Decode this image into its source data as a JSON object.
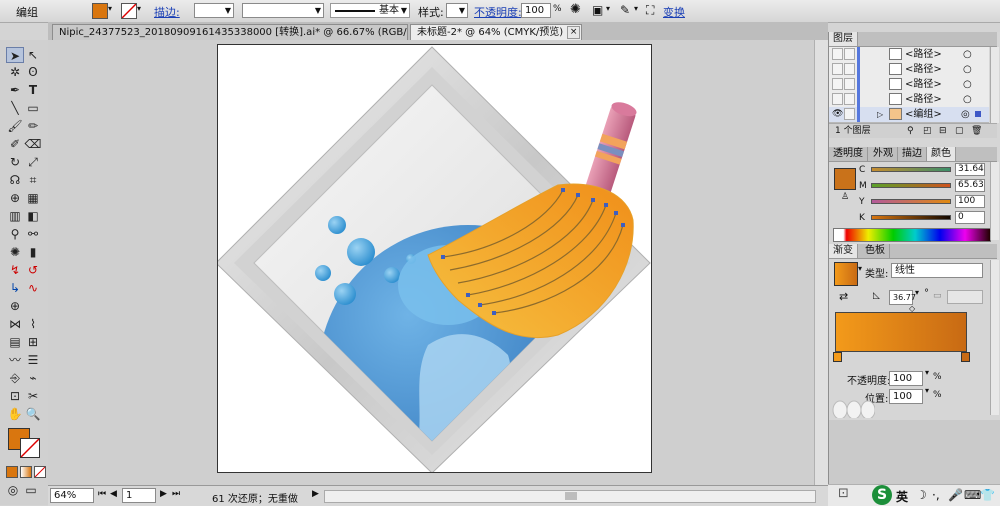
{
  "control_bar": {
    "group_label": "编组",
    "stroke_label": "描边:",
    "brush_label": "基本",
    "style_label": "样式:",
    "opacity_label": "不透明度:",
    "opacity_value": "100",
    "opacity_unit": "%",
    "transform_label": "变换"
  },
  "tabs": [
    {
      "label": "Nipic_24377523_20180909161435338000 [转换].ai* @ 66.67% (RGB/预览)"
    },
    {
      "label": "未标题-2* @ 64% (CMYK/预览)"
    }
  ],
  "status": {
    "zoom": "64%",
    "page": "1",
    "history": "61 次还原；无重做"
  },
  "layers_panel": {
    "title": "图层",
    "items": [
      {
        "label": "<路径>"
      },
      {
        "label": "<路径>"
      },
      {
        "label": "<路径>"
      },
      {
        "label": "<路径>"
      },
      {
        "label": "<编组>"
      }
    ],
    "count_label": "1 个图层"
  },
  "color_panel": {
    "tabs": [
      "透明度",
      "外观",
      "描边",
      "颜色"
    ],
    "sliders": [
      {
        "label": "C",
        "value": "31.64"
      },
      {
        "label": "M",
        "value": "65.63"
      },
      {
        "label": "Y",
        "value": "100"
      },
      {
        "label": "K",
        "value": "0"
      }
    ],
    "colors": {
      "fill": "#c9721a"
    }
  },
  "gradient_panel": {
    "tabs": [
      "渐变",
      "色板"
    ],
    "type_label": "类型:",
    "type_value": "线性",
    "angle_value": "36.77",
    "degree_symbol": "°",
    "opacity_label": "不透明度:",
    "opacity_value": "100",
    "position_label": "位置:",
    "position_value": "100",
    "pct": "%",
    "colors": {
      "start": "#f39a1a",
      "end": "#c86a14"
    }
  },
  "taskbar": {
    "ime_label": "英"
  }
}
